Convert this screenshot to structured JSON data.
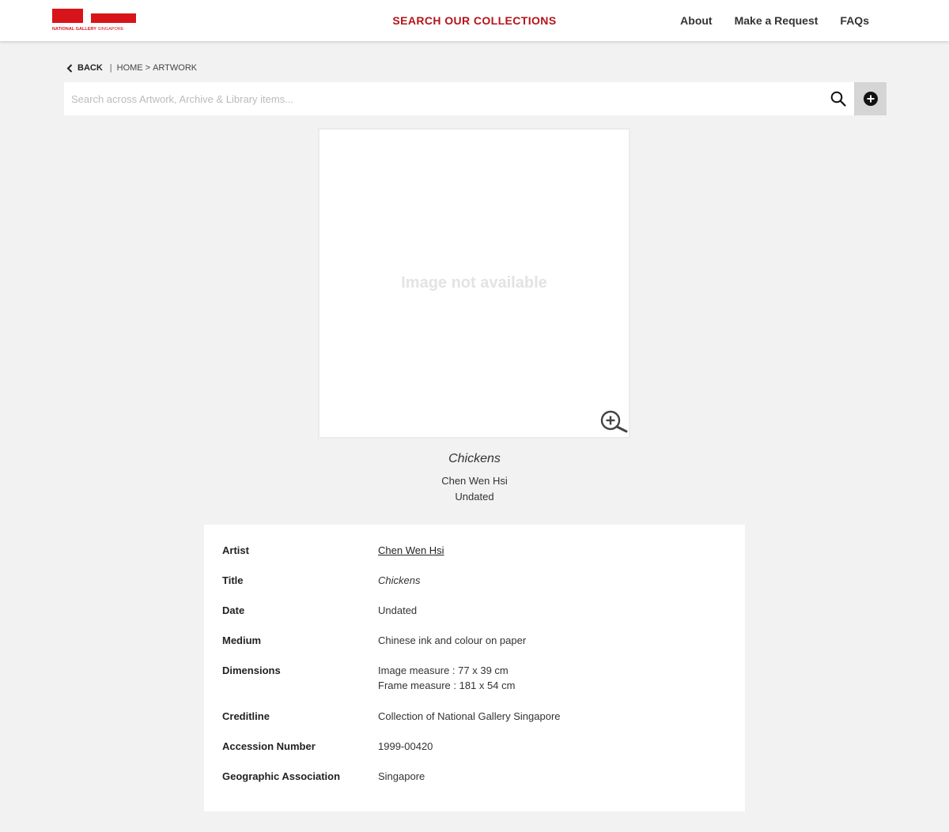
{
  "header": {
    "logo": {
      "text_bold": "NATIONAL GALLERY",
      "text_light": "SINGAPORE",
      "brand_color": "#d7141a"
    },
    "center_link": "SEARCH OUR COLLECTIONS",
    "nav": [
      "About",
      "Make a Request",
      "FAQs"
    ]
  },
  "breadcrumb": {
    "back_label": "BACK",
    "separator": "|",
    "home": "HOME",
    "arrow": ">",
    "current": "ARTWORK"
  },
  "search": {
    "placeholder": "Search across Artwork, Archive & Library items...",
    "search_icon": "magnifier-icon",
    "add_icon": "plus-circle-icon"
  },
  "artwork_image": {
    "placeholder_text": "Image not available",
    "zoom_icon": "zoom-in-icon"
  },
  "caption": {
    "title": "Chickens",
    "artist": "Chen Wen Hsi",
    "date": "Undated"
  },
  "details": [
    {
      "label": "Artist",
      "value": "Chen Wen Hsi"
    },
    {
      "label": "Title",
      "value": "Chickens"
    },
    {
      "label": "Date",
      "value": "Undated"
    },
    {
      "label": "Medium",
      "value": "Chinese ink and colour on paper"
    },
    {
      "label": "Dimensions",
      "value": "Image measure : 77 x 39 cm",
      "value2": "Frame measure : 181 x 54 cm"
    },
    {
      "label": "Creditline",
      "value": "Collection of National Gallery Singapore"
    },
    {
      "label": "Accession Number",
      "value": "1999-00420"
    },
    {
      "label": "Geographic Association",
      "value": "Singapore"
    }
  ]
}
